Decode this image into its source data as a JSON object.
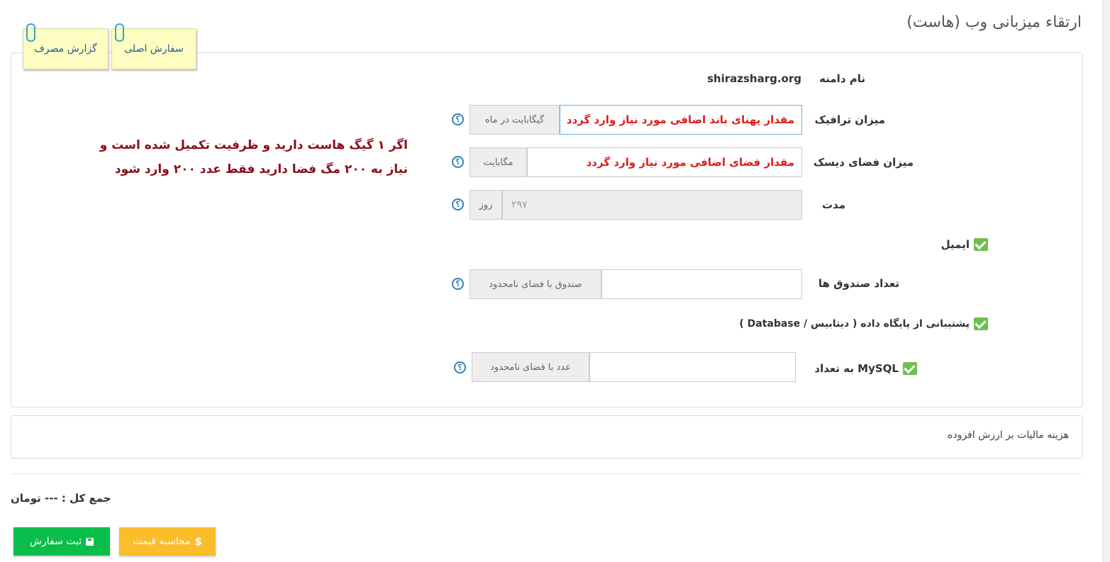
{
  "page": {
    "title": "ارتقاء میزبانی وب (هاست)"
  },
  "tabs": [
    {
      "label": "سفارش اصلی",
      "active": true
    },
    {
      "label": "گزارش مصرف",
      "active": false
    }
  ],
  "form": {
    "domain": {
      "label": "نام دامنه",
      "value": "shirazsharg.org"
    },
    "traffic": {
      "label": "میزان ترافیک",
      "value": "مقدار پهنای باند اضافی مورد نیاز وارد گردد",
      "unit": "گیگابایت در ماه"
    },
    "disk": {
      "label": "میزان فضای دیسک",
      "value": "مقدار فضای  اضافی مورد نیاز وارد گردد",
      "unit": "مگابایت"
    },
    "duration": {
      "label": "مدت",
      "value": "۲۹۷",
      "unit": "روز"
    },
    "email": {
      "label": "ایمیل",
      "checked": true
    },
    "mailboxes": {
      "label": "تعداد صندوق ها",
      "value": "",
      "unit": "صندوق با فضای نامحدود"
    },
    "database": {
      "label": "پشتیبانی از پایگاه داده ( دیتابیس / Database )",
      "checked": true
    },
    "mysql": {
      "label": "MySQL به تعداد",
      "checked": true,
      "value": "",
      "unit": "عدد با فضای نامحدود"
    }
  },
  "help_icon_glyph": "؟",
  "annotation": {
    "line1": "اگر ۱ گیگ هاست دارید و ظرفیت تکمیل شده است و",
    "line2": "نیاز به ۲۰۰ مگ فضا دارید  فقط عدد ۲۰۰ وارد شود"
  },
  "tax": {
    "label": "هزینه مالیات بر ارزش افزوده"
  },
  "total": {
    "label": "جمع کل :",
    "value": "---",
    "currency": "تومان"
  },
  "buttons": {
    "submit": "ثبت سفارش",
    "calculate": "محاسبه قیمت"
  },
  "colors": {
    "annotation": "#8b0d18",
    "hint_red": "#e11b1b",
    "submit_bg": "#0bbd4a",
    "calculate_bg": "#fbbd2a",
    "tab_note_bg": "#fdfdc2",
    "help_icon": "#2f86b5"
  }
}
